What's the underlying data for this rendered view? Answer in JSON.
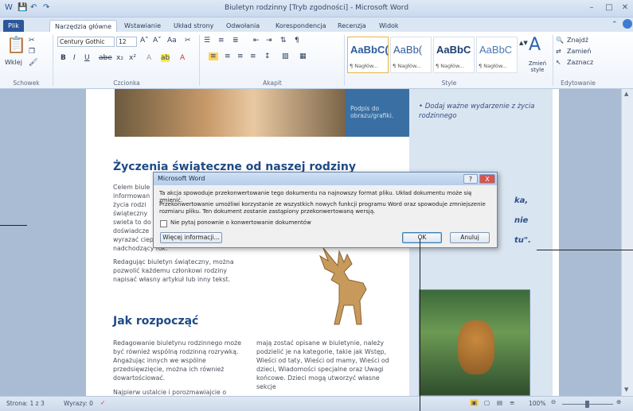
{
  "window": {
    "title": "Biuletyn rodzinny [Tryb zgodności] - Microsoft Word",
    "minimize_icon": "minimize-icon",
    "maximize_icon": "maximize-icon",
    "close_icon": "close-icon"
  },
  "tabs": [
    {
      "label": "Plik"
    },
    {
      "label": "Narzędzia główne"
    },
    {
      "label": "Wstawianie"
    },
    {
      "label": "Układ strony"
    },
    {
      "label": "Odwołania"
    },
    {
      "label": "Korespondencja"
    },
    {
      "label": "Recenzja"
    },
    {
      "label": "Widok"
    }
  ],
  "ribbon": {
    "clipboard": {
      "paste": "Wklej",
      "label": "Schowek"
    },
    "font": {
      "name": "Century Gothic",
      "size": "12",
      "label": "Czcionka"
    },
    "paragraph": {
      "label": "Akapit"
    },
    "styles": {
      "label": "Style",
      "items": [
        {
          "sample": "AaBbC(",
          "name": "¶ Nagłów..."
        },
        {
          "sample": "AaBb(",
          "name": "¶ Nagłów..."
        },
        {
          "sample": "AaBbC",
          "name": "¶ Nagłów..."
        },
        {
          "sample": "AaBbC",
          "name": "¶ Nagłów..."
        }
      ],
      "change": "Zmień style"
    },
    "editing": {
      "label": "Edytowanie",
      "find": "Znajdź",
      "replace": "Zamień",
      "select": "Zaznacz"
    }
  },
  "document": {
    "caption": "Podpis do obrazu/grafiki.",
    "sidebar_bullet": "Dodaj ważne wydarzenie z życia rodzinnego",
    "side_fragments": [
      "ka,",
      "nie",
      "tu\"."
    ],
    "heading1": "Życzenia świąteczne od naszej rodziny",
    "para1_lines": [
      "Celem biule",
      "informowan",
      "życia rodzi",
      "świąteczny",
      "swieta to do",
      "doświadcze",
      "wyrazać ciepłe",
      "nadchodzący rok."
    ],
    "para2": "Redagując biuletyn świąteczny, można pozwolić każdemu członkowi rodziny napisać własny artykuł lub inny tekst.",
    "heading2": "Jak rozpocząć",
    "col1": "Redagowanie biuletynu rodzinnego może być również wspólną rodzinną rozrywką. Angażując innych we wspólne przedsięwzięcie, można ich również dowartościować.",
    "col1b": "Najpierw ustalcie i porozmawiajcie o",
    "col2": "mają zostać opisane w biuletynie, należy podzielić je na kategorie, takie jak Wstęp, Wieści od taty, Wieści od mamy, Wieści od dzieci, Wiadomości specjalne oraz Uwagi końcowe. Dzieci mogą utworzyć własne sekcje"
  },
  "dialog": {
    "title": "Microsoft Word",
    "message1": "Ta akcja spowoduje przekonwertowanie tego dokumentu na najnowszy format pliku. Układ dokumentu może się zmienić.",
    "message2": "Przekonwertowanie umożliwi korzystanie ze wszystkich nowych funkcji programu Word oraz spowoduje zmniejszenie rozmiaru pliku. Ten dokument zostanie zastąpiony przekonwertowaną wersją.",
    "checkbox": "Nie pytaj ponownie o konwertowanie dokumentów",
    "more": "Więcej informacji...",
    "ok": "OK",
    "cancel": "Anuluj",
    "help": "?",
    "close": "X"
  },
  "status": {
    "page": "Strona: 1 z 3",
    "words": "Wyrazy: 0",
    "zoom": "100%"
  }
}
